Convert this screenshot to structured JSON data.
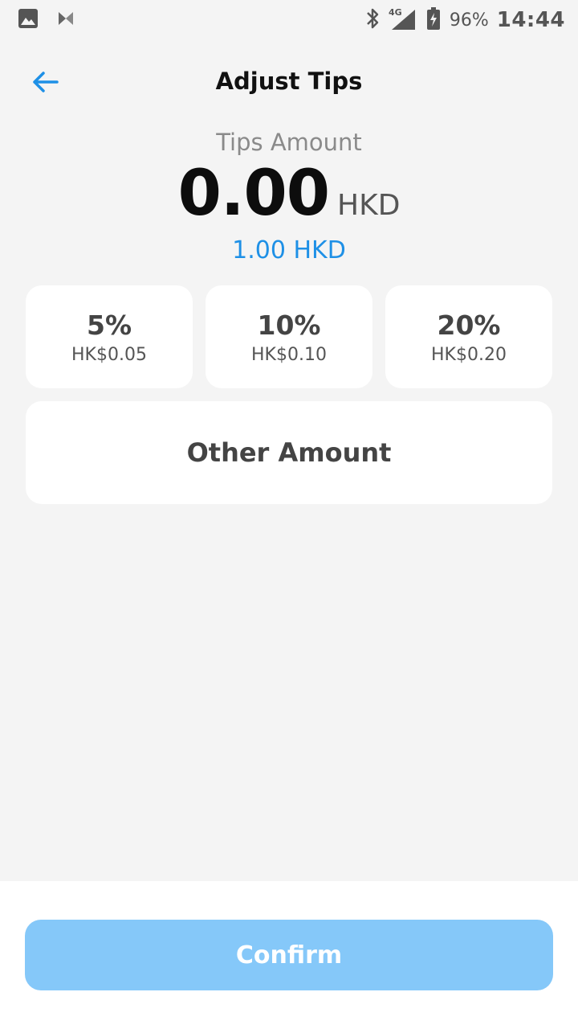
{
  "status_bar": {
    "battery_percent": "96%",
    "time": "14:44",
    "network": "4G",
    "icons": [
      "image-icon",
      "app-icon",
      "bluetooth-icon",
      "signal-icon",
      "battery-icon"
    ]
  },
  "header": {
    "title": "Adjust Tips",
    "back_icon": "arrow-left-icon"
  },
  "amount": {
    "label": "Tips Amount",
    "value": "0.00",
    "currency": "HKD",
    "base_amount": "1.00 HKD"
  },
  "tip_options": [
    {
      "percent": "5%",
      "value": "HK$0.05"
    },
    {
      "percent": "10%",
      "value": "HK$0.10"
    },
    {
      "percent": "20%",
      "value": "HK$0.20"
    }
  ],
  "other_amount": {
    "label": "Other Amount"
  },
  "confirm": {
    "label": "Confirm"
  },
  "colors": {
    "accent": "#1e90e6",
    "confirm_button": "#85c8f9",
    "background": "#f4f4f4",
    "card": "#ffffff"
  }
}
